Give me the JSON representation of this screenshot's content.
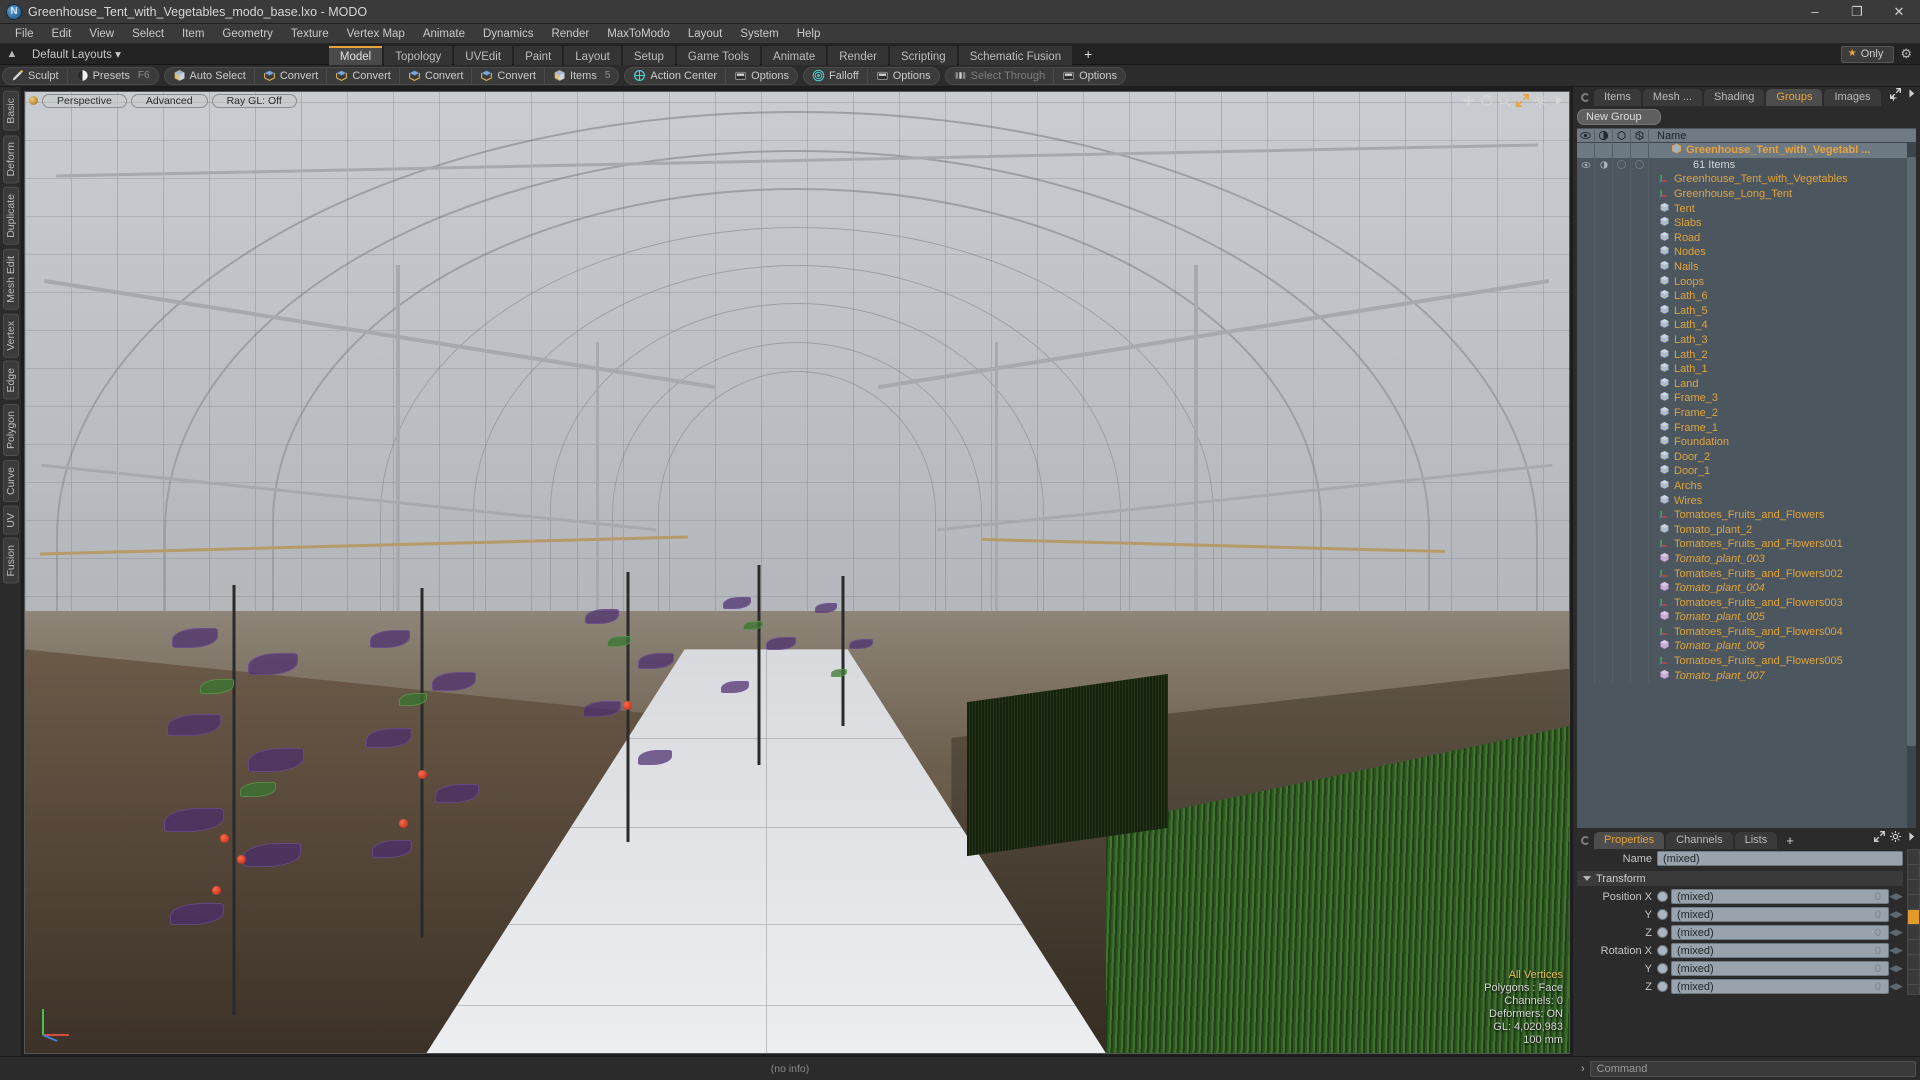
{
  "window": {
    "title": "Greenhouse_Tent_with_Vegetables_modo_base.lxo - MODO",
    "app_icon": "modo-logo-icon",
    "minimize": "–",
    "maximize": "❐",
    "close": "✕"
  },
  "menubar": {
    "items": [
      "File",
      "Edit",
      "View",
      "Select",
      "Item",
      "Geometry",
      "Texture",
      "Vertex Map",
      "Animate",
      "Dynamics",
      "Render",
      "MaxToModo",
      "Layout",
      "System",
      "Help"
    ]
  },
  "layoutbar": {
    "home_icon": "home-icon",
    "default_layouts": "Default Layouts ▾",
    "tabs": [
      {
        "label": "Model",
        "active": true
      },
      {
        "label": "Topology",
        "active": false
      },
      {
        "label": "UVEdit",
        "active": false
      },
      {
        "label": "Paint",
        "active": false
      },
      {
        "label": "Layout",
        "active": false
      },
      {
        "label": "Setup",
        "active": false
      },
      {
        "label": "Game Tools",
        "active": false
      },
      {
        "label": "Animate",
        "active": false
      },
      {
        "label": "Render",
        "active": false
      },
      {
        "label": "Scripting",
        "active": false
      },
      {
        "label": "Schematic Fusion",
        "active": false
      }
    ],
    "add_tab": "+",
    "only_button": "Only",
    "only_star": "★",
    "gear_icon": "gear-icon"
  },
  "toolbar": {
    "groups": [
      {
        "buttons": [
          {
            "label": "Sculpt",
            "icon": "sculpt-brush-icon",
            "hotkey": ""
          },
          {
            "label": "Presets",
            "icon": "presets-sphere-icon",
            "hotkey": "F6"
          }
        ]
      },
      {
        "buttons": [
          {
            "label": "Auto Select",
            "icon": "cube-icon",
            "hotkey": ""
          },
          {
            "label": "Convert",
            "icon": "convert-icon",
            "hotkey": ""
          },
          {
            "label": "Convert",
            "icon": "convert-icon",
            "hotkey": ""
          },
          {
            "label": "Convert",
            "icon": "convert-icon",
            "hotkey": ""
          },
          {
            "label": "Convert",
            "icon": "convert-icon",
            "hotkey": ""
          },
          {
            "label": "Items",
            "icon": "cube-icon",
            "hotkey": "5"
          }
        ]
      },
      {
        "buttons": [
          {
            "label": "Action Center",
            "icon": "action-center-icon",
            "hotkey": ""
          },
          {
            "label": "Options",
            "icon": "options-icon",
            "hotkey": ""
          }
        ]
      },
      {
        "buttons": [
          {
            "label": "Falloff",
            "icon": "falloff-icon",
            "hotkey": ""
          },
          {
            "label": "Options",
            "icon": "options-icon",
            "hotkey": ""
          }
        ]
      },
      {
        "buttons": [
          {
            "label": "Select Through",
            "icon": "select-through-icon",
            "hotkey": "",
            "dim": true
          },
          {
            "label": "Options",
            "icon": "options-icon",
            "hotkey": ""
          }
        ]
      }
    ]
  },
  "left_tabs": [
    "Basic",
    "Deform",
    "Duplicate",
    "Mesh Edit",
    "Vertex",
    "Edge",
    "Polygon",
    "Curve",
    "UV",
    "Fusion"
  ],
  "viewport": {
    "pills": [
      "Perspective",
      "Advanced",
      "Ray GL: Off"
    ],
    "tool_icons": [
      "pan-icon",
      "rotate-icon",
      "zoom-icon",
      "fit-icon",
      "gear-icon",
      "chevron-right-icon"
    ],
    "info": {
      "selection": "All Vertices",
      "polygons": "Polygons : Face",
      "channels": "Channels: 0",
      "deformers": "Deformers: ON",
      "gl": "GL: 4,020,983",
      "grid": "100 mm"
    },
    "status": "(no info)"
  },
  "right_panel": {
    "tabs": [
      {
        "label": "Items",
        "active": false
      },
      {
        "label": "Mesh ...",
        "active": false
      },
      {
        "label": "Shading",
        "active": false
      },
      {
        "label": "Groups",
        "active": true
      },
      {
        "label": "Images",
        "active": false
      }
    ],
    "add_tab": "+",
    "expand_icon": "expand-icon",
    "chevron_icon": "chevron-right-icon",
    "new_group_button": "New Group",
    "tree_columns": [
      "eye-icon",
      "shade-icon",
      "wireframe-icon",
      "render-icon"
    ],
    "name_column": "Name",
    "tree": [
      {
        "label": "Greenhouse_Tent_with_Vegetabl  ...",
        "type": "group",
        "depth": 0,
        "selected": true,
        "italic": false
      },
      {
        "label": "61 Items",
        "type": "count",
        "depth": 1,
        "selected": false,
        "italic": false
      },
      {
        "label": "Greenhouse_Tent_with_Vegetables",
        "type": "locator",
        "depth": 1,
        "selected": false,
        "italic": false
      },
      {
        "label": "Greenhouse_Long_Tent",
        "type": "locator",
        "depth": 1,
        "selected": false,
        "italic": false
      },
      {
        "label": "Tent",
        "type": "mesh",
        "depth": 1,
        "selected": false,
        "italic": false
      },
      {
        "label": "Slabs",
        "type": "mesh",
        "depth": 1,
        "selected": false,
        "italic": false
      },
      {
        "label": "Road",
        "type": "mesh",
        "depth": 1,
        "selected": false,
        "italic": false
      },
      {
        "label": "Nodes",
        "type": "mesh",
        "depth": 1,
        "selected": false,
        "italic": false
      },
      {
        "label": "Nails",
        "type": "mesh",
        "depth": 1,
        "selected": false,
        "italic": false
      },
      {
        "label": "Loops",
        "type": "mesh",
        "depth": 1,
        "selected": false,
        "italic": false
      },
      {
        "label": "Lath_6",
        "type": "mesh",
        "depth": 1,
        "selected": false,
        "italic": false
      },
      {
        "label": "Lath_5",
        "type": "mesh",
        "depth": 1,
        "selected": false,
        "italic": false
      },
      {
        "label": "Lath_4",
        "type": "mesh",
        "depth": 1,
        "selected": false,
        "italic": false
      },
      {
        "label": "Lath_3",
        "type": "mesh",
        "depth": 1,
        "selected": false,
        "italic": false
      },
      {
        "label": "Lath_2",
        "type": "mesh",
        "depth": 1,
        "selected": false,
        "italic": false
      },
      {
        "label": "Lath_1",
        "type": "mesh",
        "depth": 1,
        "selected": false,
        "italic": false
      },
      {
        "label": "Land",
        "type": "mesh",
        "depth": 1,
        "selected": false,
        "italic": false
      },
      {
        "label": "Frame_3",
        "type": "mesh",
        "depth": 1,
        "selected": false,
        "italic": false
      },
      {
        "label": "Frame_2",
        "type": "mesh",
        "depth": 1,
        "selected": false,
        "italic": false
      },
      {
        "label": "Frame_1",
        "type": "mesh",
        "depth": 1,
        "selected": false,
        "italic": false
      },
      {
        "label": "Foundation",
        "type": "mesh",
        "depth": 1,
        "selected": false,
        "italic": false
      },
      {
        "label": "Door_2",
        "type": "mesh",
        "depth": 1,
        "selected": false,
        "italic": false
      },
      {
        "label": "Door_1",
        "type": "mesh",
        "depth": 1,
        "selected": false,
        "italic": false
      },
      {
        "label": "Archs",
        "type": "mesh",
        "depth": 1,
        "selected": false,
        "italic": false
      },
      {
        "label": "Wires",
        "type": "mesh",
        "depth": 1,
        "selected": false,
        "italic": false
      },
      {
        "label": "Tomatoes_Fruits_and_Flowers",
        "type": "locator",
        "depth": 1,
        "selected": false,
        "italic": false
      },
      {
        "label": "Tomato_plant_2",
        "type": "mesh",
        "depth": 1,
        "selected": false,
        "italic": false
      },
      {
        "label": "Tomatoes_Fruits_and_Flowers001",
        "type": "locator",
        "depth": 1,
        "selected": false,
        "italic": false
      },
      {
        "label": "Tomato_plant_003",
        "type": "instance",
        "depth": 1,
        "selected": false,
        "italic": true
      },
      {
        "label": "Tomatoes_Fruits_and_Flowers002",
        "type": "locator",
        "depth": 1,
        "selected": false,
        "italic": false
      },
      {
        "label": "Tomato_plant_004",
        "type": "instance",
        "depth": 1,
        "selected": false,
        "italic": true
      },
      {
        "label": "Tomatoes_Fruits_and_Flowers003",
        "type": "locator",
        "depth": 1,
        "selected": false,
        "italic": false
      },
      {
        "label": "Tomato_plant_005",
        "type": "instance",
        "depth": 1,
        "selected": false,
        "italic": true
      },
      {
        "label": "Tomatoes_Fruits_and_Flowers004",
        "type": "locator",
        "depth": 1,
        "selected": false,
        "italic": false
      },
      {
        "label": "Tomato_plant_006",
        "type": "instance",
        "depth": 1,
        "selected": false,
        "italic": true
      },
      {
        "label": "Tomatoes_Fruits_and_Flowers005",
        "type": "locator",
        "depth": 1,
        "selected": false,
        "italic": false
      },
      {
        "label": "Tomato_plant_007",
        "type": "instance",
        "depth": 1,
        "selected": false,
        "italic": true
      }
    ]
  },
  "properties": {
    "tabs": [
      {
        "label": "Properties",
        "active": true
      },
      {
        "label": "Channels",
        "active": false
      },
      {
        "label": "Lists",
        "active": false
      }
    ],
    "add_tab": "+",
    "name_label": "Name",
    "name_value": "(mixed)",
    "transform_header": "Transform",
    "rows": [
      {
        "label": "Position X",
        "value": "(mixed)",
        "zero": "0"
      },
      {
        "label": "Y",
        "value": "(mixed)",
        "zero": "0"
      },
      {
        "label": "Z",
        "value": "(mixed)",
        "zero": "0"
      },
      {
        "label": "Rotation X",
        "value": "(mixed)",
        "zero": "0"
      },
      {
        "label": "Y",
        "value": "(mixed)",
        "zero": "0"
      },
      {
        "label": "Z",
        "value": "(mixed)",
        "zero": "0"
      }
    ]
  },
  "commandbar": {
    "label": "Command",
    "arrow": "›"
  },
  "colors": {
    "accent_orange": "#e8a33d",
    "tree_item_text": "#e0a33c",
    "panel_bg": "#2b2b2b",
    "tree_bg": "#4c565e",
    "field_bg": "#98a3ad"
  }
}
